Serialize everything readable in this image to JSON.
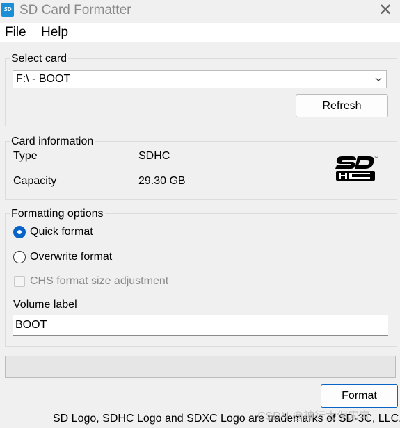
{
  "window": {
    "title": "SD Card Formatter",
    "icon": "sd-card-icon",
    "icon_text": "SD"
  },
  "menu": [
    "File",
    "Help"
  ],
  "select_card": {
    "title": "Select card",
    "selected": "F:\\ - BOOT",
    "refresh_label": "Refresh"
  },
  "card_info": {
    "title": "Card information",
    "type_label": "Type",
    "type_value": "SDHC",
    "capacity_label": "Capacity",
    "capacity_value": "29.30 GB",
    "logo": "sdhc-logo"
  },
  "formatting": {
    "title": "Formatting options",
    "quick_label": "Quick format",
    "quick_checked": true,
    "overwrite_label": "Overwrite format",
    "overwrite_checked": false,
    "chs_label": "CHS format size adjustment",
    "chs_enabled": false,
    "volume_label_title": "Volume label",
    "volume_label_value": "BOOT"
  },
  "progress": {
    "value": 0
  },
  "format_label": "Format",
  "footer_text": "SD Logo, SDHC Logo and SDXC Logo are trademarks of SD-3C, LLC.",
  "watermark": "CSDN @神行太保宋宝",
  "colors": {
    "accent": "#0a63c7",
    "background": "#f0f0f0",
    "disabled_text": "#8a8a8a"
  }
}
